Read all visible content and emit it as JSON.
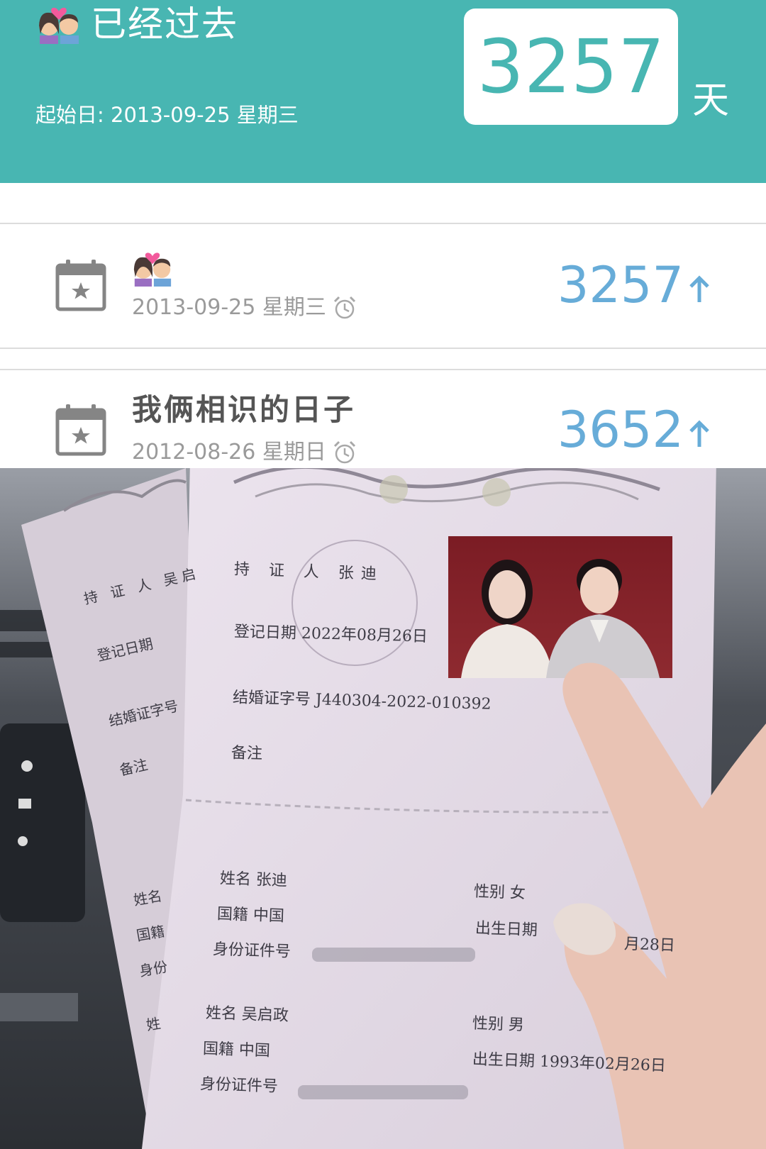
{
  "header": {
    "emoji": "couple-with-heart",
    "title": "已经过去",
    "start_date_label": "起始日: 2013-09-25 星期三",
    "counter_value": "3257",
    "counter_unit": "天",
    "bg_color": "#48b6b2"
  },
  "events": [
    {
      "icon": "calendar-star-icon",
      "title_emoji": "couple-with-heart",
      "title": "",
      "date": "2013-09-25 星期三",
      "days": "3257",
      "direction": "up-arrow"
    },
    {
      "icon": "calendar-star-icon",
      "title": "我俩相识的日子",
      "date": "2012-08-26 星期日",
      "days": "3652",
      "direction": "up-arrow"
    }
  ],
  "photo": {
    "front": {
      "holder": "持 证 人 张迪",
      "reg_date": "登记日期 2022年08月26日",
      "cert_no": "结婚证字号 J440304-2022-010392",
      "note": "备注",
      "name1": "姓名 张迪",
      "nationality1": "国籍 中国",
      "id1": "身份证件号",
      "sex1": "性别 女",
      "birth1": "出生日期",
      "birth1_value": "月28日",
      "name2": "姓名 吴启政",
      "nationality2": "国籍 中国",
      "id2": "身份证件号",
      "sex2": "性别 男",
      "birth2": "出生日期 1993年02月26日"
    },
    "back": {
      "holder": "持 证 人 吴启",
      "reg_date": "登记日期",
      "cert_no": "结婚证字号",
      "note": "备注",
      "name": "姓名",
      "nationality": "国籍",
      "id": "身份",
      "name2": "姓"
    }
  }
}
